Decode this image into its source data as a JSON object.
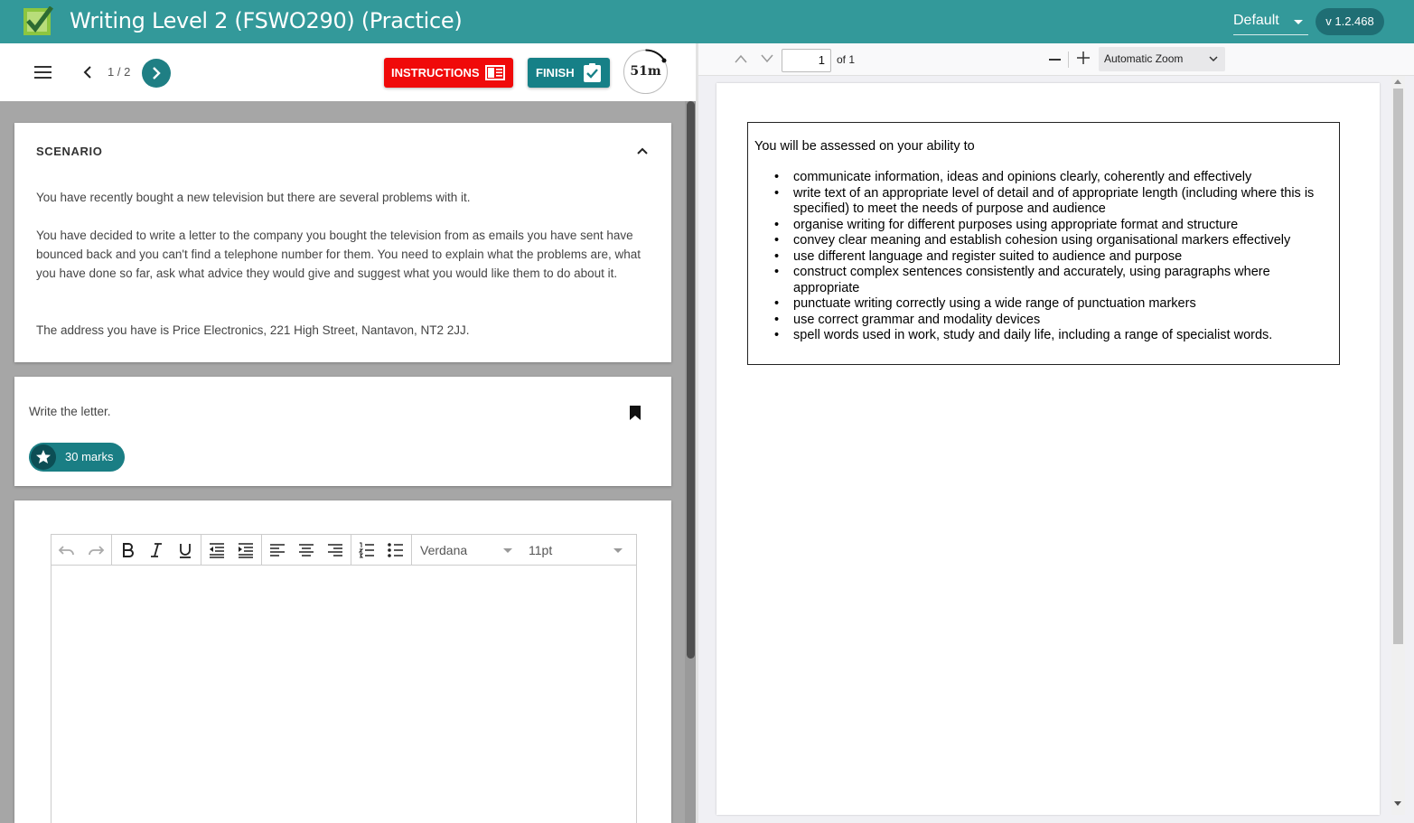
{
  "header": {
    "title": "Writing Level 2 (FSWO290) (Practice)",
    "theme_value": "Default",
    "version": "v 1.2.468"
  },
  "toolbar": {
    "page_counter": "1 / 2",
    "instructions_label": "INSTRUCTIONS",
    "finish_label": "FINISH",
    "timer": "51m"
  },
  "scenario": {
    "heading": "SCENARIO",
    "paragraphs": [
      "You have recently bought a new television but there are several problems with it.",
      "You have decided to write a letter to the company you bought the television from as emails you have sent have bounced back and you can't find a telephone number for them.  You need to explain what the problems are, what you have done so far, ask what advice they would give and suggest what you would like them to do about it.",
      "The address you have is Price Electronics, 221 High Street, Nantavon, NT2 2JJ."
    ]
  },
  "task": {
    "text": "Write the letter.",
    "marks": "30 marks"
  },
  "editor": {
    "font": "Verdana",
    "size": "11pt",
    "tools": [
      "undo",
      "redo",
      "bold",
      "italic",
      "underline",
      "outdent",
      "indent",
      "align-left",
      "align-center",
      "align-right",
      "numbered-list",
      "bulleted-list"
    ]
  },
  "pdf": {
    "page_value": "1",
    "of_label": "of 1",
    "zoom": "Automatic Zoom",
    "intro": "You will be assessed on your ability to",
    "items": [
      "communicate information, ideas and opinions clearly, coherently and effectively",
      "write text of an appropriate level of detail and of appropriate length (including where this is specified) to meet the needs of purpose and audience",
      "organise writing for different purposes using appropriate format and structure",
      "convey clear meaning and establish cohesion using organisational markers effectively",
      "use different language and register suited to audience and purpose",
      "construct complex sentences consistently and accurately, using paragraphs where appropriate",
      "punctuate writing correctly using a wide range of punctuation markers",
      "use correct grammar and modality devices",
      "spell words used in work, study and daily life, including a range of specialist words."
    ]
  },
  "colors": {
    "header_bg": "#33999a",
    "accent_dark": "#1f6e74",
    "instructions_red": "#f00a0a",
    "finish_teal": "#168087"
  }
}
